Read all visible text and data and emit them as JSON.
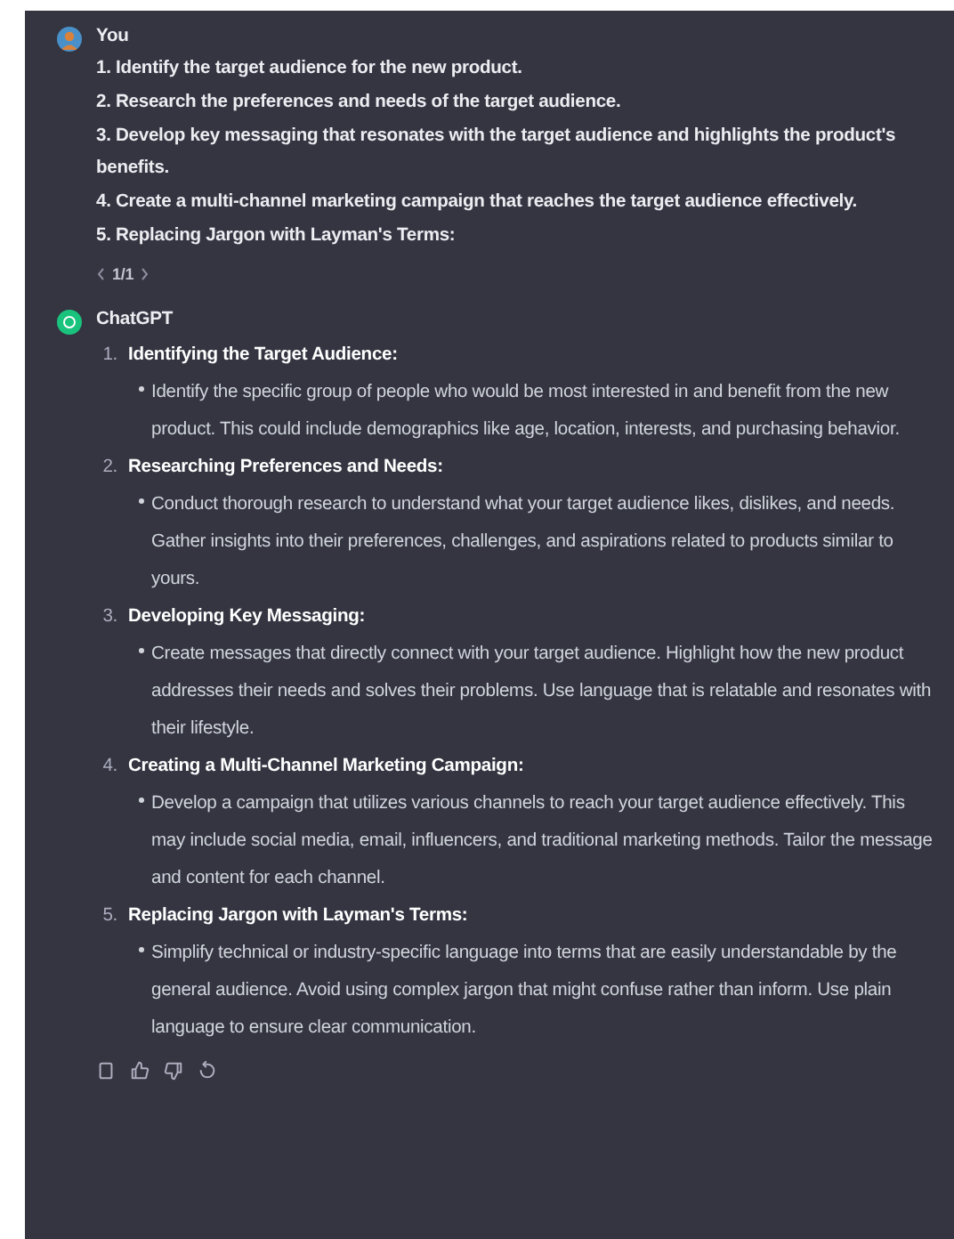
{
  "messages": [
    {
      "kind": "user",
      "author": "You",
      "lines": [
        "1. Identify the target audience for the new product.",
        "2. Research the preferences and needs of the target audience.",
        "3. Develop key messaging that resonates with the target audience and highlights the product's benefits.",
        "4. Create a multi-channel marketing campaign that reaches the target audience effectively.",
        "5. Replacing Jargon with Layman's Terms:"
      ],
      "pager": "1/1"
    },
    {
      "kind": "assistant",
      "author": "ChatGPT",
      "items": [
        {
          "number": "1.",
          "title": "Identifying the Target Audience:",
          "bullet": "Identify the specific group of people who would be most interested in and benefit from the new product. This could include demographics like age, location, interests, and purchasing behavior."
        },
        {
          "number": "2.",
          "title": "Researching Preferences and Needs:",
          "bullet": "Conduct thorough research to understand what your target audience likes, dislikes, and needs. Gather insights into their preferences, challenges, and aspirations related to products similar to yours."
        },
        {
          "number": "3.",
          "title": "Developing Key Messaging:",
          "bullet": "Create messages that directly connect with your target audience. Highlight how the new product addresses their needs and solves their problems. Use language that is relatable and resonates with their lifestyle."
        },
        {
          "number": "4.",
          "title": "Creating a Multi-Channel Marketing Campaign:",
          "bullet": "Develop a campaign that utilizes various channels to reach your target audience effectively. This may include social media, email, influencers, and traditional marketing methods. Tailor the message and content for each channel."
        },
        {
          "number": "5.",
          "title": "Replacing Jargon with Layman's Terms:",
          "bullet": "Simplify technical or industry-specific language into terms that are easily understandable by the general audience. Avoid using complex jargon that might confuse rather than inform. Use plain language to ensure clear communication."
        }
      ]
    }
  ]
}
